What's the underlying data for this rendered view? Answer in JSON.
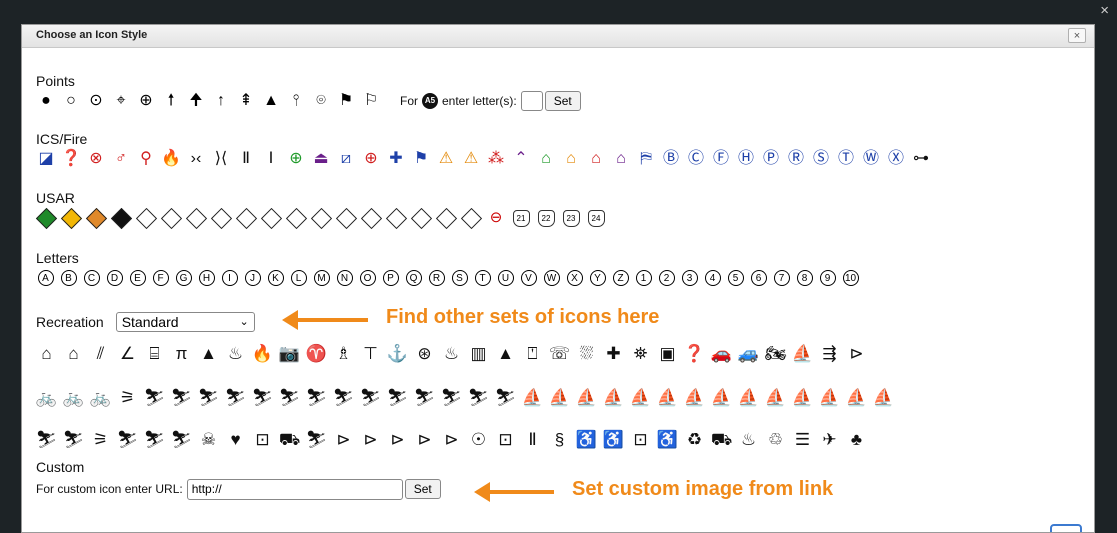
{
  "dialog": {
    "title": "Choose an Icon Style",
    "close": "×",
    "outer_close": "×"
  },
  "points": {
    "title": "Points",
    "icons": [
      "●",
      "○",
      "⊙",
      "⌖",
      "⊕",
      "🠕",
      "🠉",
      "↑",
      "⇞",
      "▲",
      "⫯",
      "⌾",
      "⚑",
      "⚐"
    ],
    "for_label": "For",
    "badge": "A5",
    "enter_label": "enter letter(s):",
    "set_label": "Set"
  },
  "ics": {
    "title": "ICS/Fire",
    "icons": [
      "◪",
      "❓",
      "⊗",
      "♂",
      "⚲",
      "🔥",
      "›‹",
      "⟩⟨",
      "Ⅱ",
      "Ⅰ",
      "⊕",
      "⏏",
      "⧄",
      "⊕",
      "✚",
      "⚑",
      "⚠",
      "⚠",
      "⁂",
      "⌃",
      "⌂",
      "⌂",
      "⌂",
      "⌂",
      "⛿",
      "Ⓑ",
      "Ⓒ",
      "Ⓕ",
      "Ⓗ",
      "Ⓟ",
      "Ⓡ",
      "Ⓢ",
      "Ⓣ",
      "Ⓦ",
      "Ⓧ",
      "⊶"
    ],
    "colors": [
      "blue",
      "blue",
      "red",
      "red",
      "red",
      "red",
      "blk",
      "blk",
      "blk",
      "blk",
      "grn",
      "pur",
      "blue",
      "red",
      "blue",
      "blue",
      "org",
      "org",
      "red",
      "pur",
      "grn",
      "org",
      "red",
      "pur",
      "blue",
      "blue",
      "blue",
      "blue",
      "blue",
      "blue",
      "blue",
      "blue",
      "blue",
      "blue",
      "blue",
      "blk"
    ]
  },
  "usar": {
    "title": "USAR",
    "diamonds": [
      "#1f8a2a",
      "#f2b705",
      "#e0892a",
      "#111111",
      "",
      "",
      "",
      "",
      "",
      "",
      "",
      "",
      "",
      "",
      "",
      "",
      "",
      ""
    ],
    "circles": [
      "⊖"
    ],
    "pentagons": [
      "21",
      "22",
      "23",
      "24"
    ]
  },
  "letters": {
    "title": "Letters",
    "items": [
      "A",
      "B",
      "C",
      "D",
      "E",
      "F",
      "G",
      "H",
      "I",
      "J",
      "K",
      "L",
      "M",
      "N",
      "O",
      "P",
      "Q",
      "R",
      "S",
      "T",
      "U",
      "V",
      "W",
      "X",
      "Y",
      "Z",
      "1",
      "2",
      "3",
      "4",
      "5",
      "6",
      "7",
      "8",
      "9",
      "10"
    ]
  },
  "recreation": {
    "title": "Recreation",
    "selected": "Standard",
    "row1": [
      "⌂",
      "⌂",
      "⫽",
      "∠",
      "⌸",
      "π",
      "▲",
      "♨",
      "🔥",
      "📷",
      "♈",
      "♗",
      "⊤",
      "⚓",
      "⊛",
      "♨",
      "▥",
      "▲",
      "⍞",
      "☏",
      "⛆",
      "✚",
      "⛯",
      "▣",
      "❓",
      "🚗",
      "🚙",
      "🏍",
      "⛵",
      "⇶",
      "⊳"
    ],
    "row2": [
      "🚲",
      "🚲",
      "🚲",
      "⚞",
      "⛷",
      "⛷",
      "⛷",
      "⛷",
      "⛷",
      "⛷",
      "⛷",
      "⛷",
      "⛷",
      "⛷",
      "⛷",
      "⛷",
      "⛷",
      "⛷",
      "⛵",
      "⛵",
      "⛵",
      "⛵",
      "⛵",
      "⛵",
      "⛵",
      "⛵",
      "⛵",
      "⛵",
      "⛵",
      "⛵",
      "⛵",
      "⛵"
    ],
    "row3": [
      "⛷",
      "⛷",
      "⚞",
      "⛷",
      "⛷",
      "⛷",
      "☠",
      "♥",
      "⊡",
      "⛟",
      "⛷",
      "⊳",
      "⊳",
      "⊳",
      "⊳",
      "⊳",
      "☉",
      "⊡",
      "Ⅱ",
      "§",
      "♿",
      "♿",
      "⊡",
      "♿",
      "♻",
      "⛟",
      "♨",
      "♲",
      "☰",
      "✈",
      "♣"
    ]
  },
  "custom": {
    "title": "Custom",
    "url_label": "For custom icon enter URL:",
    "url_value": "http://",
    "set_label": "Set"
  },
  "annotations": {
    "recreation_note": "Find other sets of icons here",
    "custom_note": "Set custom image from link"
  }
}
